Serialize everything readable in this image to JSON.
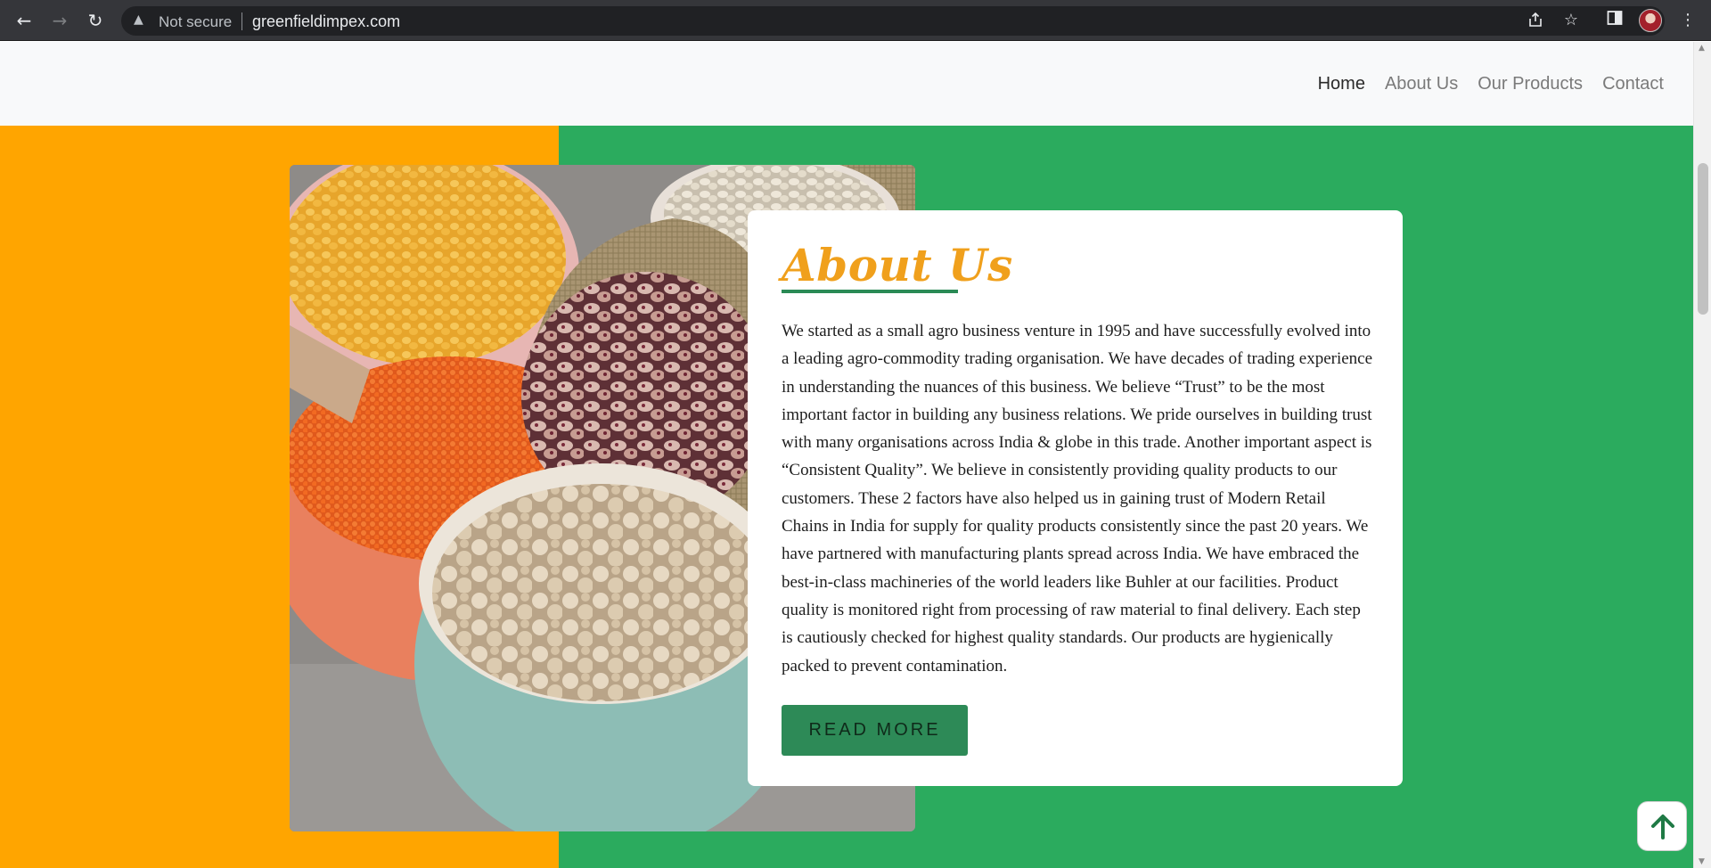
{
  "browser": {
    "security_label": "Not secure",
    "url": "greenfieldimpex.com"
  },
  "navbar": {
    "links": [
      {
        "label": "Home",
        "active": true
      },
      {
        "label": "About Us",
        "active": false
      },
      {
        "label": "Our Products",
        "active": false
      },
      {
        "label": "Contact",
        "active": false
      }
    ]
  },
  "about": {
    "title": "About Us",
    "body": "We started as a small agro business venture in 1995 and have successfully evolved into a leading agro-commodity trading organisation. We have decades of trading experience in understanding the nuances of this business. We believe “Trust” to be the most important factor in building any business relations. We pride ourselves in building trust with many organisations across India & globe in this trade. Another important aspect is “Consistent Quality”. We believe in consistently providing quality products to our customers. These 2 factors have also helped us in gaining trust of Modern Retail Chains in India for supply for quality products consistently since the past 20 years. We have partnered with manufacturing plants spread across India. We have embraced the best-in-class machineries of the world leaders like Buhler at our facilities. Product quality is monitored right from processing of raw material to final delivery. Each step is cautiously checked for highest quality standards. Our products are hygienically packed to prevent contamination.",
    "button_label": "READ MORE"
  },
  "colors": {
    "left_band": "#ffa500",
    "right_band": "#2bab5e",
    "title": "#f0a01c",
    "button": "#2d8a57"
  }
}
